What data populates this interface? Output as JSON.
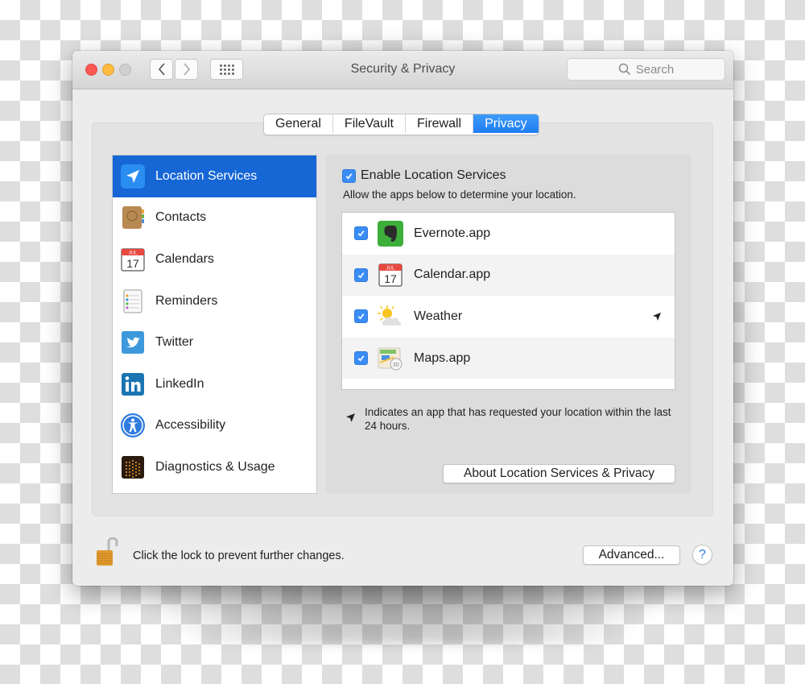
{
  "window": {
    "title": "Security & Privacy",
    "search_placeholder": "Search"
  },
  "tabs": [
    {
      "label": "General",
      "active": false
    },
    {
      "label": "FileVault",
      "active": false
    },
    {
      "label": "Firewall",
      "active": false
    },
    {
      "label": "Privacy",
      "active": true
    }
  ],
  "sidebar": {
    "items": [
      {
        "label": "Location Services",
        "icon": "location-services-icon",
        "selected": true
      },
      {
        "label": "Contacts",
        "icon": "contacts-icon",
        "selected": false
      },
      {
        "label": "Calendars",
        "icon": "calendar-icon",
        "selected": false
      },
      {
        "label": "Reminders",
        "icon": "reminders-icon",
        "selected": false
      },
      {
        "label": "Twitter",
        "icon": "twitter-icon",
        "selected": false
      },
      {
        "label": "LinkedIn",
        "icon": "linkedin-icon",
        "selected": false
      },
      {
        "label": "Accessibility",
        "icon": "accessibility-icon",
        "selected": false
      },
      {
        "label": "Diagnostics & Usage",
        "icon": "diagnostics-icon",
        "selected": false
      }
    ]
  },
  "location": {
    "enable_label": "Enable Location Services",
    "enabled": true,
    "allow_text": "Allow the apps below to determine your location.",
    "apps": [
      {
        "name": "Evernote.app",
        "icon": "evernote-icon",
        "checked": true,
        "recent_request": false
      },
      {
        "name": "Calendar.app",
        "icon": "calendar-icon",
        "checked": true,
        "recent_request": false
      },
      {
        "name": "Weather",
        "icon": "weather-icon",
        "checked": true,
        "recent_request": true
      },
      {
        "name": "Maps.app",
        "icon": "maps-icon",
        "checked": true,
        "recent_request": false
      }
    ],
    "legend_text": "Indicates an app that has requested your location within the last 24 hours.",
    "about_button": "About Location Services & Privacy"
  },
  "footer": {
    "lock_text": "Click the lock to prevent further changes.",
    "advanced_button": "Advanced...",
    "help_label": "?"
  },
  "colors": {
    "accent": "#1666d6",
    "checkbox": "#3b8df6",
    "close": "#fc5753",
    "minimize": "#fdbc40"
  },
  "calendar_icon": {
    "month": "JUL",
    "day": "17"
  }
}
